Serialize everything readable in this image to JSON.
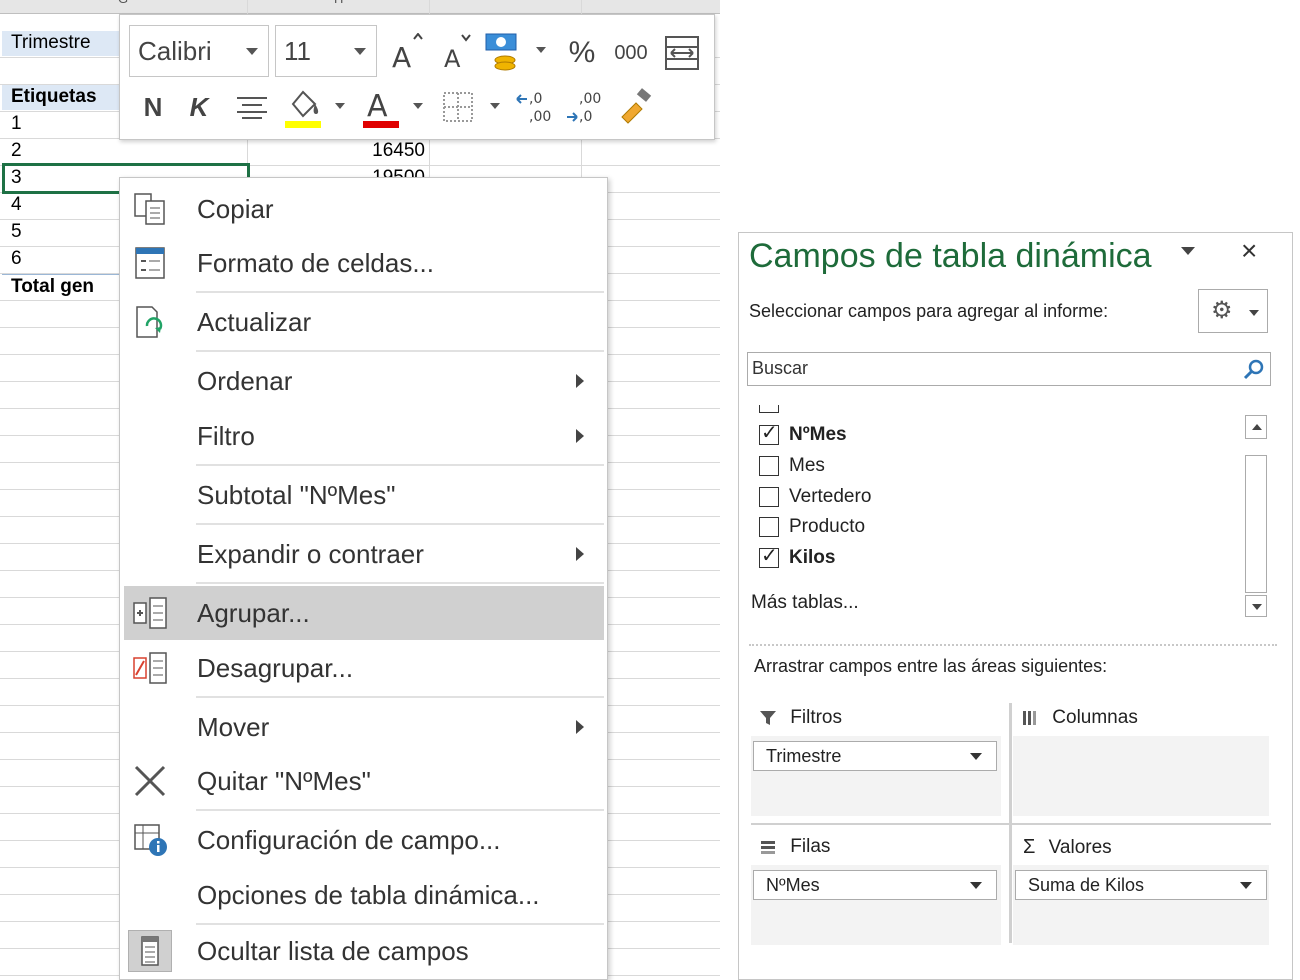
{
  "sheet": {
    "col_letters": [
      "G",
      "H"
    ],
    "trimestre_label": "Trimestre",
    "etiquetas_label": "Etiquetas",
    "rows": [
      "1",
      "2",
      "3",
      "4",
      "5",
      "6"
    ],
    "value_row2": "16450",
    "value_row3": "19500",
    "total_label": "Total gen"
  },
  "mini_toolbar": {
    "font_name": "Calibri",
    "font_size": "11",
    "bold": "N",
    "italic": "K",
    "percent": "%",
    "thousands": "000",
    "highlight_color": "#ffff00",
    "font_color": "#e00000"
  },
  "context_menu": {
    "items": [
      {
        "label": "Copiar",
        "icon": "copy-icon"
      },
      {
        "label": "Formato de celdas...",
        "icon": "format-cells-icon"
      },
      {
        "label": "Actualizar",
        "icon": "refresh-icon"
      },
      {
        "label": "Ordenar",
        "icon": ""
      },
      {
        "label": "Filtro",
        "icon": ""
      },
      {
        "label": "Subtotal \"NºMes\"",
        "icon": ""
      },
      {
        "label": "Expandir o contraer",
        "icon": ""
      },
      {
        "label": "Agrupar...",
        "icon": "group-icon"
      },
      {
        "label": "Desagrupar...",
        "icon": "ungroup-icon"
      },
      {
        "label": "Mover",
        "icon": ""
      },
      {
        "label": "Quitar \"NºMes\"",
        "icon": "remove-x-icon"
      },
      {
        "label": "Configuración de campo...",
        "icon": "field-settings-icon"
      },
      {
        "label": "Opciones de tabla dinámica...",
        "icon": ""
      },
      {
        "label": "Ocultar lista de campos",
        "icon": "field-list-icon"
      }
    ]
  },
  "pivot_pane": {
    "title": "Campos de tabla dinámica",
    "close": "×",
    "subtitle": "Seleccionar campos para agregar al informe:",
    "search_placeholder": "Buscar",
    "fields": [
      {
        "label": "NºMes",
        "checked": true
      },
      {
        "label": "Mes",
        "checked": false
      },
      {
        "label": "Vertedero",
        "checked": false
      },
      {
        "label": "Producto",
        "checked": false
      },
      {
        "label": "Kilos",
        "checked": true
      }
    ],
    "check_mark": "✓",
    "more_tables": "Más tablas...",
    "drag_text": "Arrastrar campos entre las áreas siguientes:",
    "areas": {
      "filters": {
        "label": "Filtros",
        "chip": "Trimestre"
      },
      "columns": {
        "label": "Columnas"
      },
      "rows": {
        "label": "Filas",
        "chip": "NºMes"
      },
      "values": {
        "label": "Valores",
        "chip": "Suma de Kilos",
        "symbol": "Σ"
      }
    },
    "accent_color": "#1e6b3a"
  }
}
